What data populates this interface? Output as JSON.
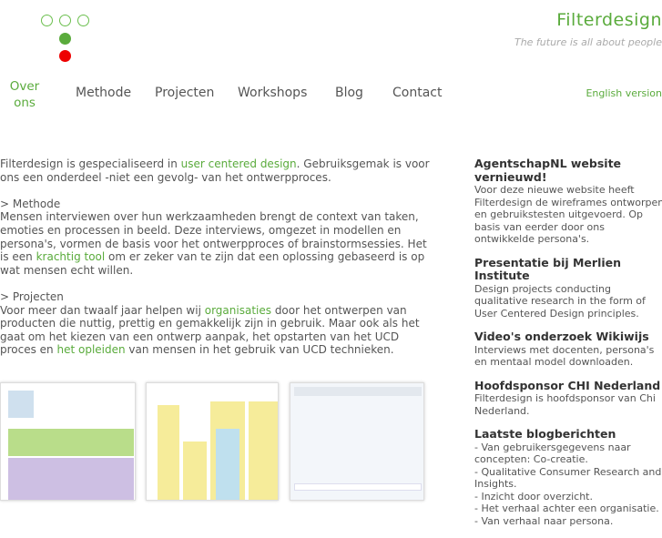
{
  "header": {
    "brand": "Filterdesign",
    "tagline": "The future is all about people"
  },
  "colors": {
    "accent": "#5aab3c",
    "logo_red": "#ee0000"
  },
  "nav": {
    "items": [
      {
        "label": "Over ons",
        "active": true
      },
      {
        "label": "Methode"
      },
      {
        "label": "Projecten"
      },
      {
        "label": "Workshops"
      },
      {
        "label": "Blog"
      },
      {
        "label": "Contact"
      }
    ],
    "english": "English version"
  },
  "main": {
    "p1": {
      "t1": "Filterdesign is gespecialiseerd in ",
      "link": "user centered design",
      "t2": ". Gebruiksgemak is voor ons een onderdeel -niet een gevolg- van het ontwerpproces."
    },
    "p2": {
      "heading": "> Methode",
      "t1": "Mensen interviewen over hun werkzaamheden brengt de context van taken, emoties en processen in beeld. Deze interviews, omgezet in modellen en persona's, vormen de basis voor het ontwerpproces of brainstormsessies. Het is een ",
      "link": "krachtig tool",
      "t2": " om er zeker van te zijn dat een oplossing gebaseerd is op wat mensen echt willen."
    },
    "p3": {
      "heading": "> Projecten",
      "t1": "Voor meer dan twaalf jaar helpen wij ",
      "link1": "organisaties",
      "t2": " door het ontwerpen van producten die nuttig, prettig en gemakkelijk zijn in gebruik. Maar ook als het gaat om het kiezen van een ontwerp aanpak, het opstarten van het UCD proces en ",
      "link2": "het opleiden",
      "t3": " van mensen in het gebruik van UCD technieken."
    }
  },
  "sidebar": {
    "items": [
      {
        "title": "AgentschapNL website vernieuwd!",
        "text": "Voor deze nieuwe website heeft Filterdesign de wireframes ontworpen en gebruikstesten uitgevoerd. Op basis van eerder door ons ontwikkelde persona's."
      },
      {
        "title": "Presentatie bij Merlien Institute",
        "text": "Design projects conducting qualitative research in the form of User Centered Design principles."
      },
      {
        "title": "Video's onderzoek Wikiwijs",
        "text": "Interviews met docenten, persona's en mentaal model downloaden."
      },
      {
        "title": "Hoofdsponsor CHI Nederland",
        "text": "Filterdesign is hoofdsponsor van Chi Nederland."
      }
    ],
    "blog": {
      "title": "Laatste blogberichten",
      "posts": [
        "- Van gebruikersgegevens naar concepten:   Co-creatie.",
        "- Qualitative Consumer Research and Insights.",
        "- Inzicht door overzicht.",
        "- Het verhaal achter een organisatie.",
        "- Van verhaal naar persona."
      ]
    }
  }
}
